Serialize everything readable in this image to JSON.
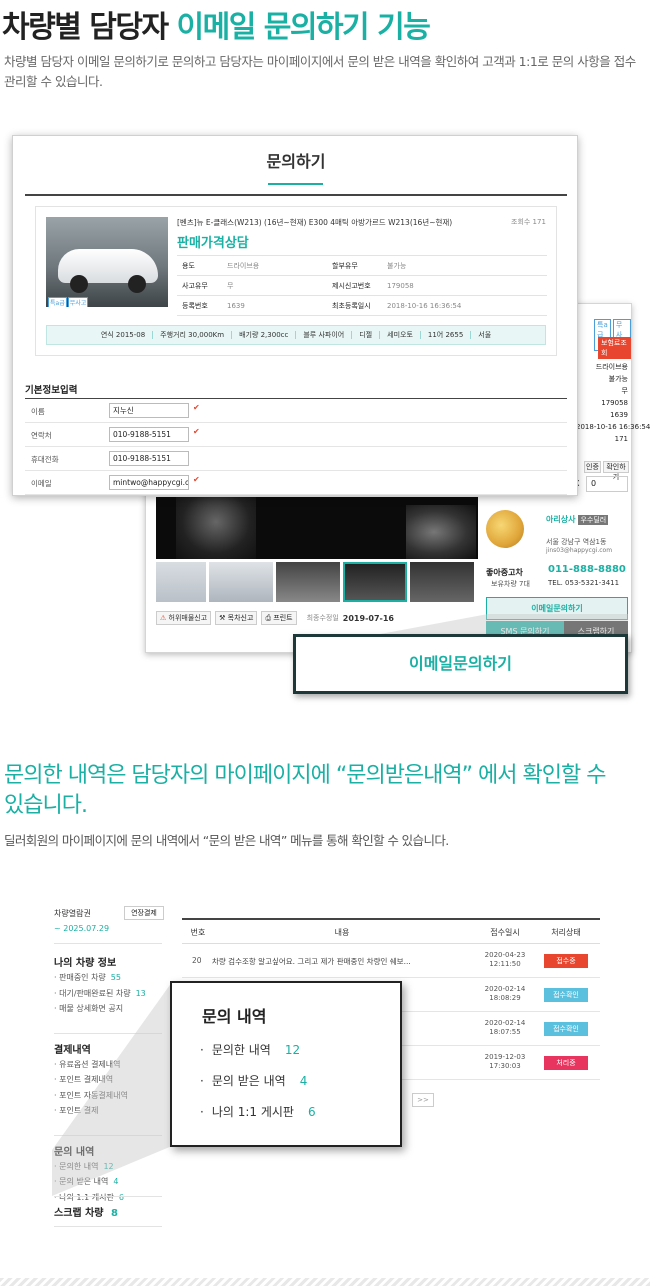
{
  "section1": {
    "title_dark": "차량별 담당자",
    "title_teal": "이메일 문의하기 기능",
    "desc": "차량별 담당자 이메일 문의하기로 문의하고 담당자는 마이페이지에서 문의 받은 내역을 확인하여 고객과 1:1로 문의 사항을 접수 관리할 수 있습니다."
  },
  "inquiry_form": {
    "title": "문의하기",
    "car_name": "[벤츠]뉴 E-클래스(W213) (16년~현재) E300 4매틱 아방가르드 W213(16년~현재)",
    "view_count": "조회수 171",
    "consult": "판매가격상담",
    "specs": [
      {
        "label": "용도",
        "value": "드라이브용",
        "label2": "할부유무",
        "value2": "불가능"
      },
      {
        "label": "사고유무",
        "value": "무",
        "label2": "제시신고번호",
        "value2": "179058"
      },
      {
        "label": "등록번호",
        "value": "1639",
        "label2": "최초등록일시",
        "value2": "2018-10-16 16:36:54"
      }
    ],
    "bar": [
      "연식 2015-08",
      "주행거리 30,000Km",
      "배기량 2,300cc",
      "블루 사파이어",
      "디젤",
      "세미오토",
      "11어 2655",
      "서울"
    ],
    "tags": [
      "특a급",
      "무사고"
    ],
    "basic_title": "기본정보입력",
    "fields": [
      {
        "label": "이름",
        "value": "지누신",
        "required": true
      },
      {
        "label": "연락처",
        "value": "010-9188-5151",
        "required": true
      },
      {
        "label": "휴대전화",
        "value": "010-9188-5151",
        "required": false
      },
      {
        "label": "이메일",
        "value": "mintwo@happycgi.com",
        "required": true
      }
    ]
  },
  "detail_card": {
    "tags": [
      "특a급",
      "무사고"
    ],
    "insurance": "보험료조회",
    "values": [
      "드라이브용",
      "불가능",
      "무",
      "179058",
      "1639",
      "2018-10-16 16:36:54",
      "171"
    ],
    "btn_a": "인증",
    "btn_b": "확인하기",
    "input_value": "0",
    "x_label": "X",
    "dealer_name": "아리상사",
    "dealer_badge": "우수딜러",
    "dealer_addr": "서울 강남구 역삼1동",
    "dealer_email": "jins03@happycgi.com",
    "dealer_rank": "좋아중고차",
    "dealer_cars": "보유차량 7대",
    "phone": "011-888-8880",
    "tel": "TEL. 053-5321-3411",
    "email_btn": "이메일문의하기",
    "sms_btn": "SMS 문의하기",
    "scrap_btn": "스크랩하기",
    "actions": [
      "허위매물신고",
      "목차신고",
      "프린트"
    ],
    "modified": "최종수정일",
    "modified_date": "2019-07-16",
    "callout": "이메일문의하기"
  },
  "section2": {
    "title": "문의한 내역은 담당자의 마이페이지에 “문의받은내역” 에서 확인할 수 있습니다.",
    "desc": "딜러회원의 마이페이지에 문의 내역에서 “문의 받은 내역” 메뉴를 통해 확인할 수 있습니다."
  },
  "mypage": {
    "ticket_label": "차량열람권",
    "ticket_btn": "연장결제",
    "ticket_date": "~ 2025.07.29",
    "groups": [
      {
        "title": "나의 차량 정보",
        "items": [
          {
            "label": "판매중인 차량",
            "count": "55"
          },
          {
            "label": "대기/판매완료된 차량",
            "count": "13"
          },
          {
            "label": "매물 상세화면 공지",
            "count": ""
          }
        ]
      },
      {
        "title": "결제내역",
        "items": [
          {
            "label": "유료옵션 결제내역",
            "count": ""
          },
          {
            "label": "포인트 결제내역",
            "count": ""
          },
          {
            "label": "포인트 자동결제내역",
            "count": ""
          },
          {
            "label": "포인트 결제",
            "count": ""
          }
        ]
      },
      {
        "title": "문의 내역",
        "items": [
          {
            "label": "문의한 내역",
            "count": "12"
          },
          {
            "label": "문의 받은 내역",
            "count": "4"
          },
          {
            "label": "나의 1:1 게시판",
            "count": "6"
          }
        ]
      }
    ],
    "scrap_title": "스크랩 차량",
    "scrap_count": "8",
    "table_headers": [
      "번호",
      "내용",
      "접수일시",
      "처리상태"
    ],
    "rows": [
      {
        "no": "20",
        "content": "차량 검수조항 알고싶어요. 그리고 제가 판매중인 차량인 쉐보...",
        "date": "2020-04-23",
        "time": "12:11:50",
        "status": "접수중",
        "color": "#e8462f"
      },
      {
        "no": "",
        "content": "",
        "date": "2020-02-14",
        "time": "18:08:29",
        "status": "접수확인",
        "color": "#5bc0de"
      },
      {
        "no": "",
        "content": "",
        "date": "2020-02-14",
        "time": "18:07:55",
        "status": "접수확인",
        "color": "#5bc0de"
      },
      {
        "no": "",
        "content": "",
        "date": "2019-12-03",
        "time": "17:30:03",
        "status": "처리중",
        "color": "#e83560"
      }
    ],
    "pager_next": ">>",
    "popup_title": "문의 내역",
    "popup_items": [
      {
        "label": "문의한 내역",
        "count": "12"
      },
      {
        "label": "문의 받은 내역",
        "count": "4"
      },
      {
        "label": "나의 1:1 게시판",
        "count": "6"
      }
    ]
  }
}
